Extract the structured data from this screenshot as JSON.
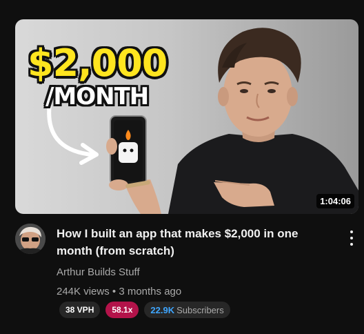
{
  "video": {
    "thumbnail": {
      "headline_price": "$2,000",
      "headline_period": "/MONTH",
      "duration": "1:04:06"
    },
    "title": "How I built an app that makes $2,000 in one month (from scratch)",
    "channel_name": "Arthur Builds Stuff",
    "views": "244K views",
    "separator": "•",
    "age": "3 months ago"
  },
  "badges": {
    "vph": "38 VPH",
    "multiplier": "58.1x",
    "subscribers_count": "22.9K",
    "subscribers_label": "Subscribers"
  },
  "icons": {
    "more": "more-vertical-icon",
    "avatar": "channel-avatar"
  },
  "colors": {
    "background": "#0f0f0f",
    "multiplier_badge": "#b3134a",
    "subscribers_count": "#3ea6ff",
    "price_text": "#ffe51f"
  }
}
